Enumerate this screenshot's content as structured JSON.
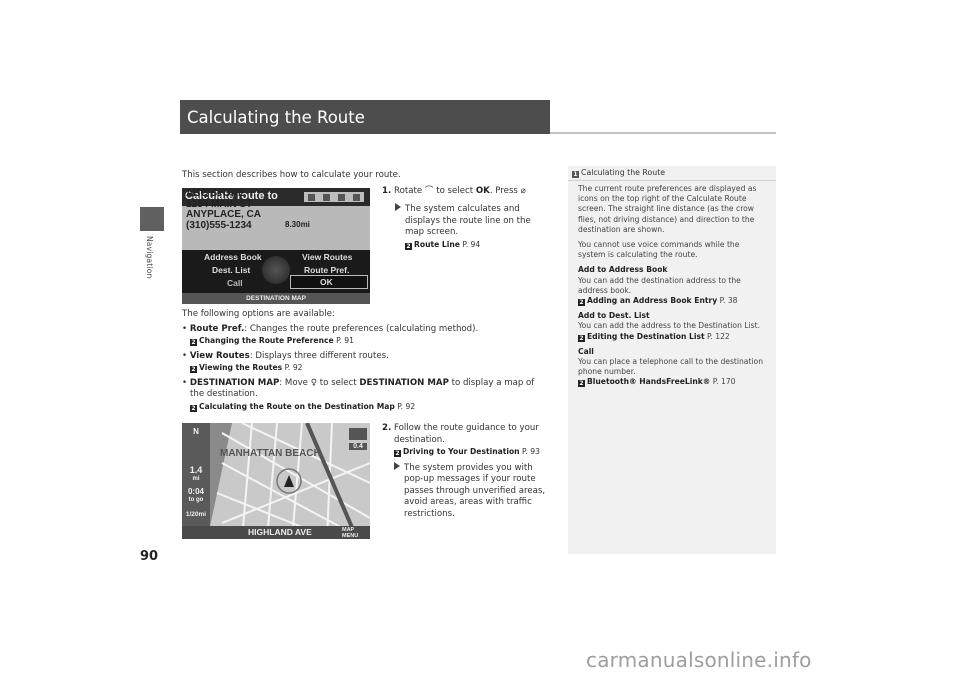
{
  "sidebar": {
    "section_label": "Navigation"
  },
  "page_number": "90",
  "header": {
    "title": "Calculating the Route"
  },
  "intro": "This section describes how to calculate your route.",
  "step1": {
    "num": "1.",
    "text_a": "Rotate",
    "text_b": "to select",
    "ok": "OK",
    "text_c": ". Press",
    "result_lines": [
      "The system calculates and",
      "displays the route line on the",
      "map screen."
    ],
    "xref_title": "Route Line",
    "xref_page": "P. 94"
  },
  "screen1": {
    "title": "Calculate route to",
    "address_lines": [
      "ABC STORE",
      "1234 MAIN ST",
      "ANYPLACE, CA",
      "(310)555-1234"
    ],
    "distance": "8.30mi",
    "menu": {
      "address_book": "Address Book",
      "dest_list": "Dest. List",
      "call": "Call",
      "view_routes": "View Routes",
      "route_pref": "Route Pref.",
      "ok": "OK",
      "destination_map": "DESTINATION MAP"
    }
  },
  "options": {
    "heading": "The following options are available:",
    "items": [
      {
        "label": "Route Pref.",
        "desc": ": Changes the route preferences (calculating method).",
        "xref_title": "Changing the Route Preference",
        "xref_page": "P. 91"
      },
      {
        "label": "View Routes",
        "desc": ": Displays three different routes.",
        "xref_title": "Viewing the Routes",
        "xref_page": "P. 92"
      },
      {
        "label": "DESTINATION MAP",
        "desc_a": ": Move",
        "desc_b": "to select",
        "label2": "DESTINATION MAP",
        "desc_c": "to display a map of",
        "desc_d": "the destination.",
        "xref_title": "Calculating the Route on the Destination Map",
        "xref_page": "P. 92"
      }
    ]
  },
  "step2": {
    "num": "2.",
    "lines": [
      "Follow the route guidance to your",
      "destination."
    ],
    "xref_title": "Driving to Your Destination",
    "xref_page": "P. 93",
    "result_lines": [
      "The system provides you with",
      "pop-up messages if your route",
      "passes through unverified areas,",
      "avoid areas, areas with traffic",
      "restrictions."
    ]
  },
  "screen2": {
    "city": "MANHATTAN BEACH",
    "street": "HIGHLAND AVE",
    "dist_value": "1.4",
    "dist_unit": "mi",
    "time_value": "0:04",
    "time_unit": "to go",
    "scale": "1/20mi",
    "right_value": "0.4",
    "map_menu": "MAP MENU"
  },
  "note": {
    "title": "Calculating the Route",
    "para1": [
      "The current route preferences are displayed as",
      "icons on the top right of the Calculate Route",
      "screen. The straight line distance (as the crow",
      "flies, not driving distance) and direction to the",
      "destination are shown."
    ],
    "para2": [
      "You cannot use voice commands while the",
      "system is calculating the route."
    ],
    "sections": [
      {
        "heading": "Add to Address Book",
        "lines": [
          "You can add the destination address to the",
          "address book."
        ],
        "xref_title": "Adding an Address Book Entry",
        "xref_page": "P. 38"
      },
      {
        "heading": "Add to Dest. List",
        "lines": [
          "You can add the address to the Destination List."
        ],
        "xref_title": "Editing the Destination List",
        "xref_page": "P. 122"
      },
      {
        "heading": "Call",
        "lines": [
          "You can place a telephone call to the destination",
          "phone number."
        ],
        "xref_title": "Bluetooth® HandsFreeLink®",
        "xref_page": "P. 170"
      }
    ]
  },
  "watermark": "carmanualsonline.info"
}
